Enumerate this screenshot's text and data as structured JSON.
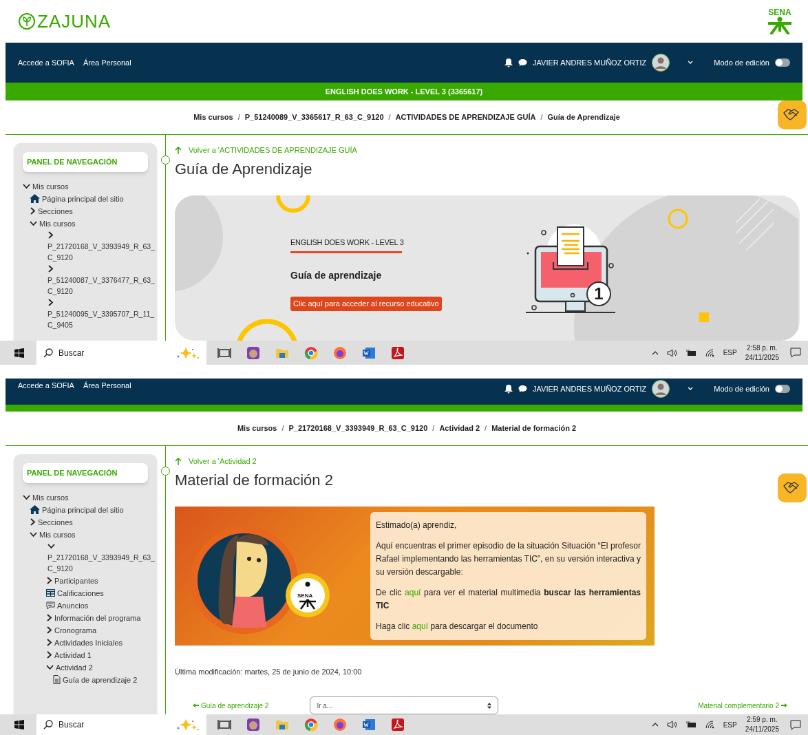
{
  "screens": [
    {
      "kind": "guide",
      "logo": {
        "text": "ZAJUNA"
      },
      "sena_logo": {
        "text": "SENA"
      },
      "navbar": {
        "links": [
          "Accede a SOFIA",
          "Área Personal"
        ],
        "user_name": "JAVIER ANDRES MUÑOZ ORTIZ",
        "edit_mode": {
          "label": "Modo de edición",
          "on": false
        }
      },
      "course_bar": "ENGLISH DOES WORK - LEVEL 3 (3365617)",
      "breadcrumb": [
        "Mis cursos",
        "P_51240089_V_3365617_R_63_C_9120",
        "ACTIVIDADES DE APRENDIZAJE GUÍA",
        "Guía de Aprendizaje"
      ],
      "breadcrumb_separator": "/",
      "sidebar": {
        "title": "PANEL DE NAVEGACIÓN",
        "tree": [
          {
            "label": "Mis cursos",
            "kind": "node",
            "expanded": true,
            "children": [
              {
                "label": "Página principal del sitio",
                "kind": "home"
              },
              {
                "label": "Secciones",
                "kind": "node",
                "expanded": false
              },
              {
                "label": "Mis cursos",
                "kind": "node",
                "expanded": true,
                "children": [
                  {
                    "label": "P_21720168_V_3393949_R_63_C_9120",
                    "kind": "course",
                    "expanded": false
                  },
                  {
                    "label": "P_51240087_V_3376477_R_63_C_9120",
                    "kind": "course",
                    "expanded": false
                  },
                  {
                    "label": "P_51240095_V_3395707_R_11_C_9405",
                    "kind": "course",
                    "expanded": false
                  }
                ]
              }
            ]
          }
        ]
      },
      "back_link": "Volver a 'ACTIVIDADES DE APRENDIZAJE GUÍA",
      "title": "Guía de Aprendizaje",
      "banner": {
        "kind": "guide",
        "course": "ENGLISH DOES WORK - LEVEL 3",
        "heading": "Guía de aprendizaje",
        "button": "Clic aquí para acceder al recurso educativo",
        "badge": "1"
      },
      "taskbar": {
        "search_placeholder": "Buscar",
        "language": "ESP",
        "time": "2:58 p. m.",
        "date": "24/11/2025"
      }
    },
    {
      "kind": "material",
      "navbar": {
        "links": [
          "Accede a SOFIA",
          "Área Personal"
        ],
        "user_name": "JAVIER ANDRES MUÑOZ ORTIZ",
        "edit_mode": {
          "label": "Modo de edición",
          "on": false
        }
      },
      "breadcrumb": [
        "Mis cursos",
        "P_21720168_V_3393949_R_63_C_9120",
        "Actividad 2",
        "Material de formación 2"
      ],
      "breadcrumb_separator": "/",
      "sidebar": {
        "title": "PANEL DE NAVEGACIÓN",
        "tree": [
          {
            "label": "Mis cursos",
            "kind": "node",
            "expanded": true,
            "children": [
              {
                "label": "Página principal del sitio",
                "kind": "home"
              },
              {
                "label": "Secciones",
                "kind": "node",
                "expanded": false
              },
              {
                "label": "Mis cursos",
                "kind": "node",
                "expanded": true,
                "children": [
                  {
                    "label": "P_21720168_V_3393949_R_63_C_9120",
                    "kind": "course",
                    "expanded": true,
                    "children": [
                      {
                        "label": "Participantes",
                        "kind": "node",
                        "expanded": false
                      },
                      {
                        "label": "Calificaciones",
                        "kind": "table"
                      },
                      {
                        "label": "Anuncios",
                        "kind": "forum"
                      },
                      {
                        "label": "Información del programa",
                        "kind": "node",
                        "expanded": false
                      },
                      {
                        "label": "Cronograma",
                        "kind": "node",
                        "expanded": false
                      },
                      {
                        "label": "Actividades Iniciales",
                        "kind": "node",
                        "expanded": false
                      },
                      {
                        "label": "Actividad 1",
                        "kind": "node",
                        "expanded": false
                      },
                      {
                        "label": "Actividad 2",
                        "kind": "node",
                        "expanded": true,
                        "children": [
                          {
                            "label": "Guía de aprendizaje 2",
                            "kind": "file"
                          }
                        ]
                      }
                    ]
                  }
                ]
              }
            ]
          }
        ]
      },
      "back_link": "Volver a 'Actividad 2",
      "title": "Material de formación 2",
      "banner": {
        "kind": "material",
        "sena_text": "SENA",
        "paragraphs": [
          [
            {
              "kind": "text",
              "text": "Estimado(a) aprendiz,"
            }
          ],
          [
            {
              "kind": "text",
              "text": "Aquí encuentras el primer episodio de la situación Situación “El profesor Rafael implementando las herramientas TIC”, en su versión interactiva y su versión descargable:"
            }
          ],
          [
            {
              "kind": "text",
              "text": "De clic "
            },
            {
              "kind": "link",
              "text": "aquí"
            },
            {
              "kind": "text",
              "text": " para ver el material multimedia "
            },
            {
              "kind": "bold",
              "text": "buscar las herramientas TIC"
            }
          ],
          [
            {
              "kind": "text",
              "text": "Haga clic "
            },
            {
              "kind": "link",
              "text": "aquí"
            },
            {
              "kind": "text",
              "text": " para descargar el documento"
            }
          ]
        ]
      },
      "last_modified": "Última modificación: martes, 25 de junio de 2024, 10:00",
      "page_nav": {
        "previous": "Guía de aprendizaje 2",
        "jump_placeholder": "Ir a...",
        "next": "Material complementario 2"
      },
      "taskbar": {
        "search_placeholder": "Buscar",
        "language": "ESP",
        "time": "2:59 p. m.",
        "date": "24/11/2025"
      }
    }
  ]
}
